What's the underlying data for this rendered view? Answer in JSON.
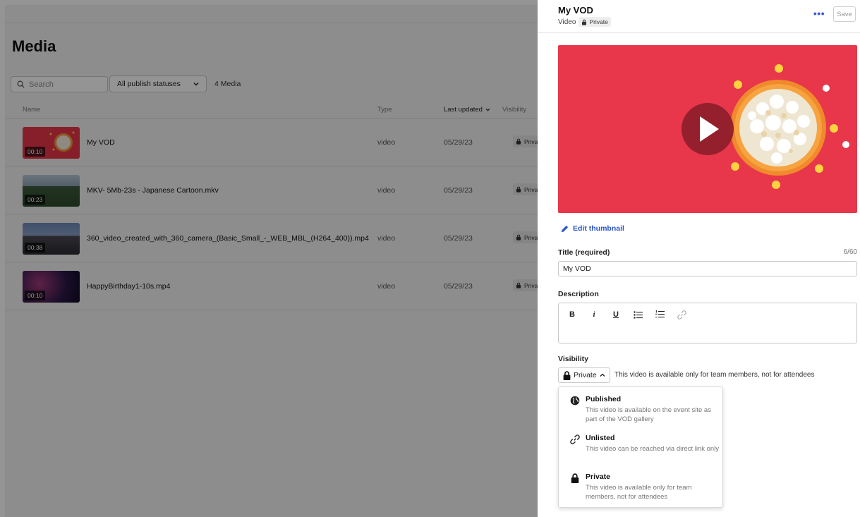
{
  "media_page": {
    "title": "Media",
    "search_placeholder": "Search",
    "status_filter": "All publish statuses",
    "media_count": "4 Media",
    "columns": {
      "name": "Name",
      "type": "Type",
      "last_updated": "Last updated",
      "visibility": "Visibility"
    },
    "rows": [
      {
        "name": "My VOD",
        "duration": "00:10",
        "type": "video",
        "date": "05/29/23",
        "visibility": "Private",
        "thumb": "popcorn"
      },
      {
        "name": "MKV- 5Mb-23s - Japanese Cartoon.mkv",
        "duration": "00:23",
        "type": "video",
        "date": "05/29/23",
        "visibility": "Private",
        "thumb": "landscape"
      },
      {
        "name": "360_video_created_with_360_camera_(Basic_Small_-_WEB_MBL_(H264_400)).mp4",
        "duration": "00:38",
        "type": "video",
        "date": "05/29/23",
        "visibility": "Private",
        "thumb": "city"
      },
      {
        "name": "HappyBirthday1-10s.mp4",
        "duration": "00:10",
        "type": "video",
        "date": "05/29/23",
        "visibility": "Private",
        "thumb": "birthday"
      }
    ]
  },
  "panel": {
    "title": "My VOD",
    "subtitle_type": "Video",
    "subtitle_badge": "Private",
    "more_label": "•••",
    "save_label": "Save",
    "edit_thumbnail": "Edit thumbnail",
    "title_label": "Title (required)",
    "title_counter": "6/60",
    "title_value": "My VOD",
    "description_label": "Description",
    "toolbar": {
      "bold": "B",
      "italic": "i",
      "underline": "U"
    },
    "visibility_label": "Visibility",
    "visibility_value": "Private",
    "visibility_help": "This video is available only for team members, not for attendees",
    "options": [
      {
        "title": "Published",
        "desc": "This video is available on the event site as part of the VOD gallery",
        "icon": "globe-icon"
      },
      {
        "title": "Unlisted",
        "desc": "This video can be reached via direct link only",
        "icon": "link-icon"
      },
      {
        "title": "Private",
        "desc": "This video is available only for team members, not for attendees",
        "icon": "lock-icon"
      }
    ]
  },
  "colors": {
    "accent": "#2b56c8",
    "video_bg": "#e8364a",
    "overlay": "#000000"
  }
}
